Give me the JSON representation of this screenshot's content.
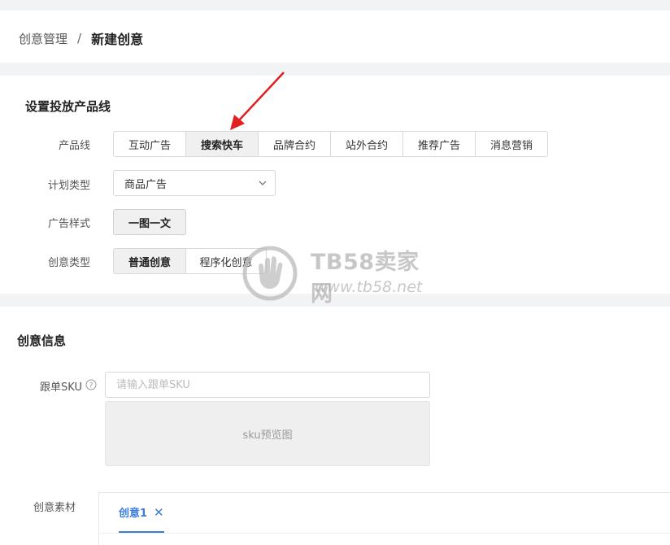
{
  "breadcrumb": {
    "parent": "创意管理",
    "separator": "/",
    "current": "新建创意"
  },
  "section_product": {
    "title": "设置投放产品线",
    "product_line_label": "产品线",
    "product_lines": [
      "互动广告",
      "搜索快车",
      "品牌合约",
      "站外合约",
      "推荐广告",
      "消息营销"
    ],
    "product_line_selected": "搜索快车",
    "plan_type_label": "计划类型",
    "plan_type_value": "商品广告",
    "ad_style_label": "广告样式",
    "ad_style_value": "一图一文",
    "creative_type_label": "创意类型",
    "creative_types": [
      "普通创意",
      "程序化创意"
    ],
    "creative_type_selected": "普通创意"
  },
  "section_info": {
    "title": "创意信息",
    "sku_label": "跟单SKU",
    "sku_value": "",
    "sku_placeholder": "请输入跟单SKU",
    "sku_preview_text": "sku预览图",
    "material_label": "创意素材",
    "material_tab_label": "创意1"
  },
  "watermark": {
    "line1": "TB58卖家网",
    "line2": "www.tb58.net"
  },
  "colors": {
    "accent_blue": "#3b7ddd",
    "annotation_red": "#e02020",
    "page_bg": "#f2f3f5"
  },
  "icons": {
    "select_chevron": "chevron-down-icon",
    "help": "question-circle-icon",
    "tab_close": "close-icon",
    "watermark_logo": "hand-logo-icon",
    "annotation": "red-arrow-icon"
  }
}
